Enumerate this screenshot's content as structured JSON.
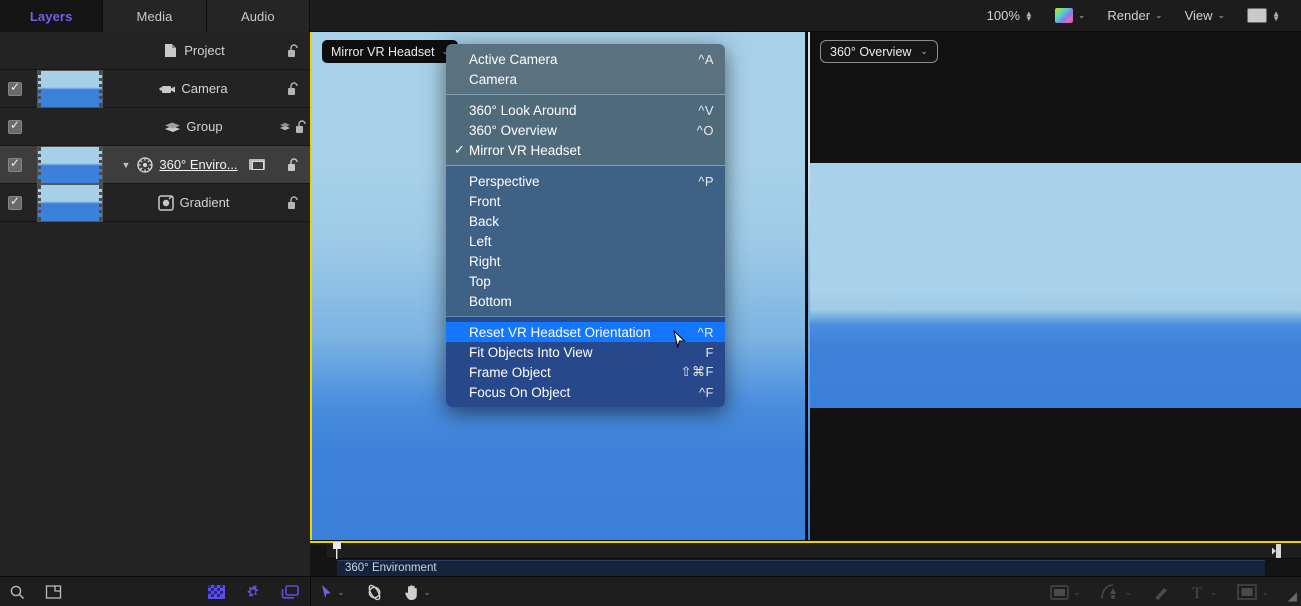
{
  "tabs": [
    {
      "label": "Layers",
      "active": true
    },
    {
      "label": "Media",
      "active": false
    },
    {
      "label": "Audio",
      "active": false
    }
  ],
  "layers": [
    {
      "name": "Project",
      "icon": "document-icon",
      "checked": false,
      "thumb": false,
      "disclosure": false,
      "badge": false,
      "selected": false,
      "groupicon": false
    },
    {
      "name": "Camera",
      "icon": "camera-icon",
      "checked": true,
      "thumb": true,
      "disclosure": false,
      "badge": false,
      "selected": false,
      "groupicon": false
    },
    {
      "name": "Group",
      "icon": "group-icon",
      "checked": true,
      "thumb": false,
      "disclosure": false,
      "badge": false,
      "selected": false,
      "groupicon": true
    },
    {
      "name": "360° Enviro...",
      "icon": "sphere-icon",
      "checked": true,
      "thumb": true,
      "disclosure": true,
      "badge": true,
      "selected": true,
      "groupicon": false
    },
    {
      "name": "Gradient",
      "icon": "gradient-icon",
      "checked": true,
      "thumb": true,
      "disclosure": false,
      "badge": false,
      "selected": false,
      "groupicon": false
    }
  ],
  "toolbar": {
    "zoom_value": "100%",
    "render_label": "Render",
    "view_label": "View"
  },
  "viewports": {
    "left": {
      "popup_label": "Mirror VR Headset"
    },
    "right": {
      "popup_label": "360° Overview"
    }
  },
  "timeline": {
    "clip_label": "360° Environment"
  },
  "menu": {
    "sections": [
      {
        "items": [
          {
            "label": "Active Camera",
            "key": "^A",
            "checked": false,
            "highlight": false
          },
          {
            "label": "Camera",
            "key": "",
            "checked": false,
            "highlight": false
          }
        ]
      },
      {
        "items": [
          {
            "label": "360° Look Around",
            "key": "^V",
            "checked": false,
            "highlight": false
          },
          {
            "label": "360° Overview",
            "key": "^O",
            "checked": false,
            "highlight": false
          },
          {
            "label": "Mirror VR Headset",
            "key": "",
            "checked": true,
            "highlight": false
          }
        ]
      },
      {
        "items": [
          {
            "label": "Perspective",
            "key": "^P",
            "checked": false,
            "highlight": false
          },
          {
            "label": "Front",
            "key": "",
            "checked": false,
            "highlight": false
          },
          {
            "label": "Back",
            "key": "",
            "checked": false,
            "highlight": false
          },
          {
            "label": "Left",
            "key": "",
            "checked": false,
            "highlight": false
          },
          {
            "label": "Right",
            "key": "",
            "checked": false,
            "highlight": false
          },
          {
            "label": "Top",
            "key": "",
            "checked": false,
            "highlight": false
          },
          {
            "label": "Bottom",
            "key": "",
            "checked": false,
            "highlight": false
          }
        ]
      },
      {
        "items": [
          {
            "label": "Reset VR Headset Orientation",
            "key": "^R",
            "checked": false,
            "highlight": true
          },
          {
            "label": "Fit Objects Into View",
            "key": "F",
            "checked": false,
            "highlight": false
          },
          {
            "label": "Frame Object",
            "key": "⇧⌘F",
            "checked": false,
            "highlight": false
          },
          {
            "label": "Focus On Object",
            "key": "^F",
            "checked": false,
            "highlight": false
          }
        ]
      }
    ]
  },
  "bottom_bar": {
    "left_icons": [
      "search-icon",
      "crop-icon"
    ],
    "right_group_icons": [
      "checkerboard-icon",
      "gear-icon",
      "layers-stack-icon"
    ],
    "tools": [
      "select-arrow-icon",
      "orbit-icon",
      "pan-hand-icon"
    ],
    "creation_tools": [
      "rect-shape-icon",
      "bezier-pen-icon",
      "paint-stroke-icon",
      "text-tool-icon",
      "mask-tool-icon"
    ]
  },
  "colors": {
    "accent_tab": "#6e62e8",
    "highlight_blue": "#1477ff",
    "viewport_border_yellow": "#e8d400",
    "menu_bg": "#536c7c"
  }
}
